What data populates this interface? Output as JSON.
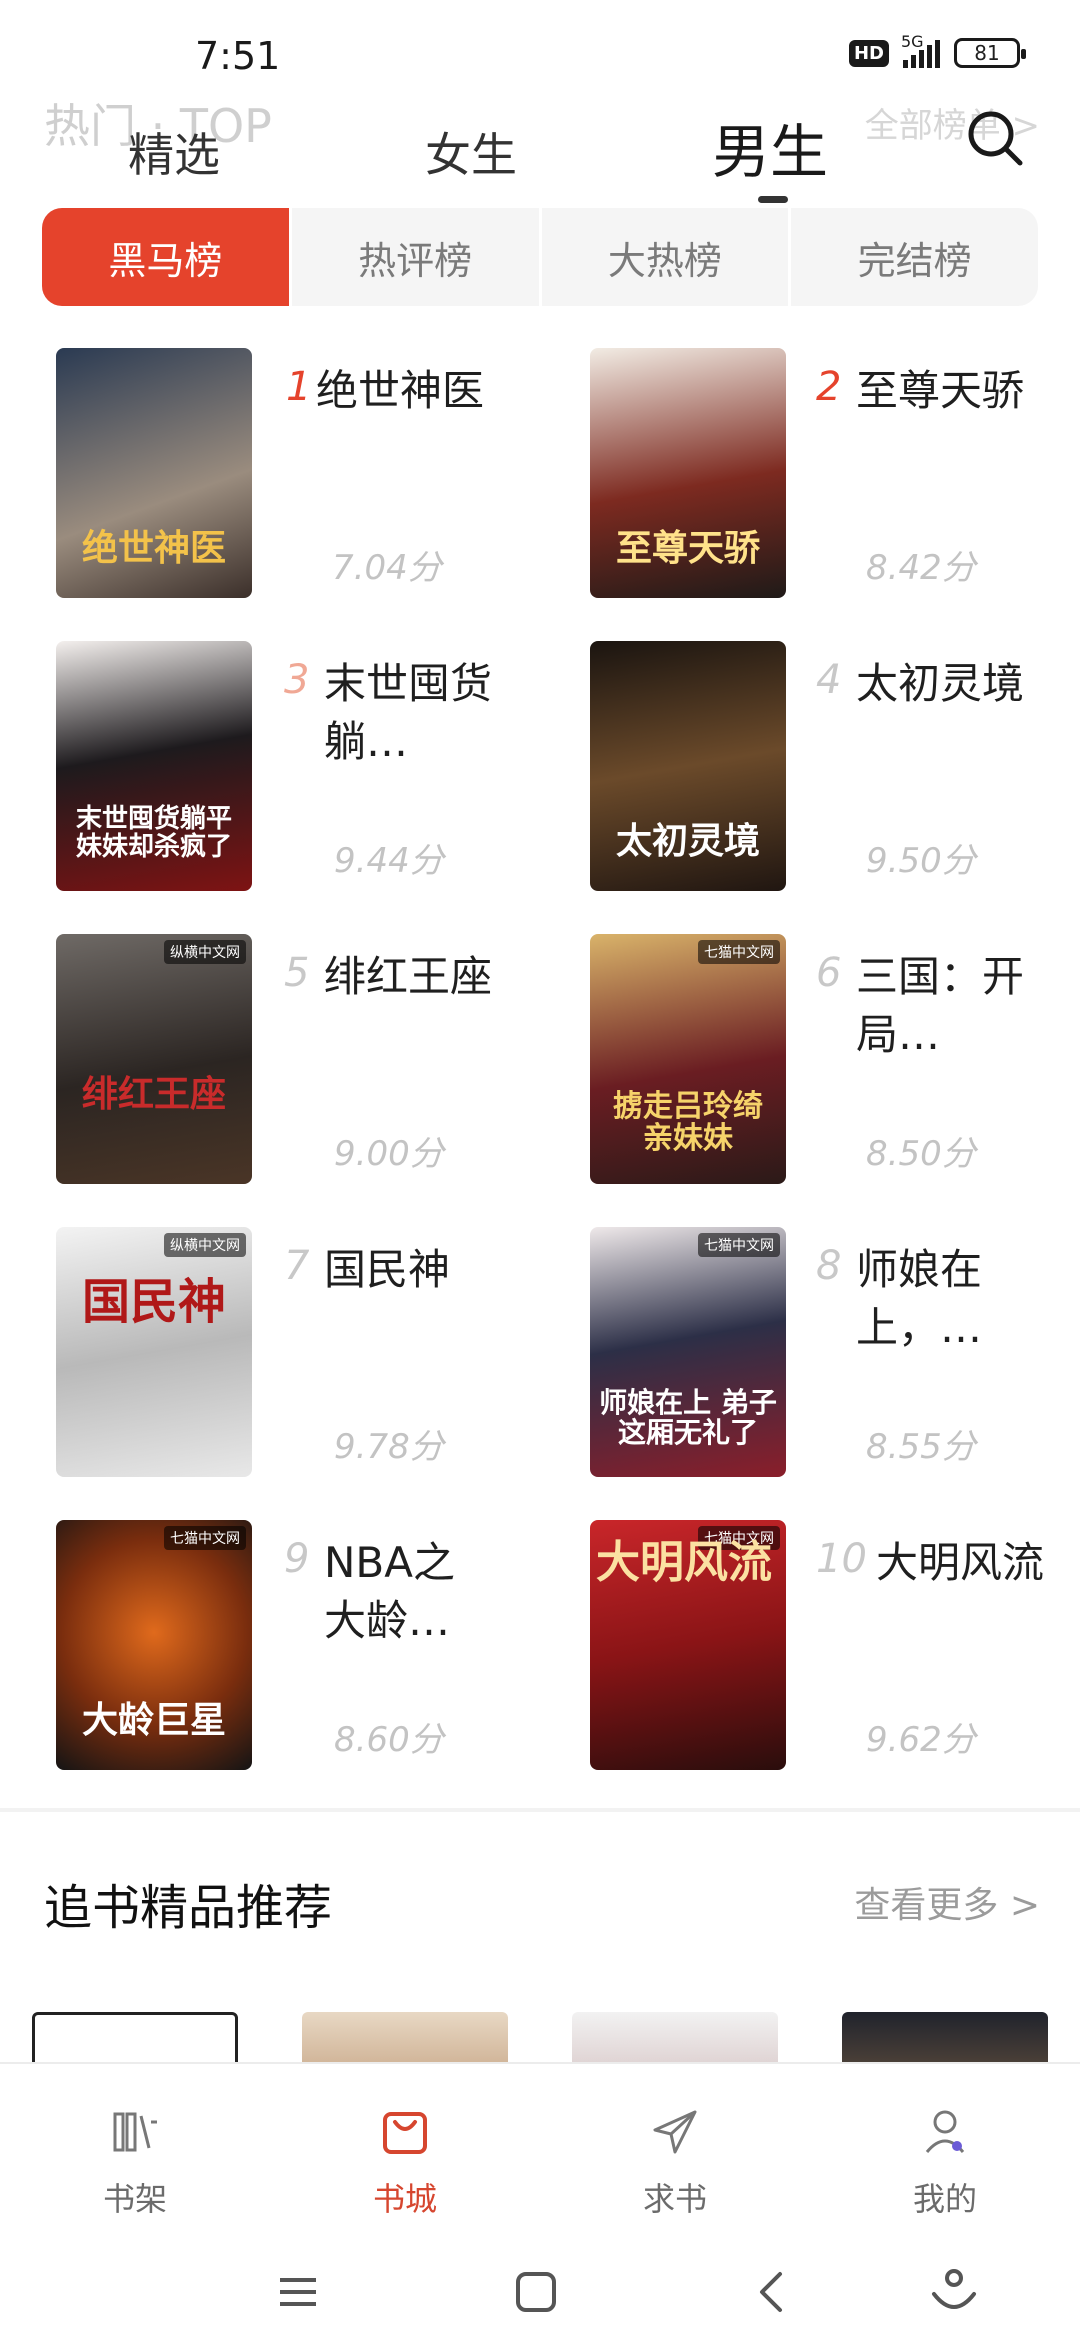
{
  "status_bar": {
    "time": "7:51",
    "hd": "HD",
    "network": "5G",
    "battery": "81"
  },
  "ghost_header": {
    "left": "热门 · TOP",
    "right": "全部榜单 >"
  },
  "top_tabs": [
    "精选",
    "女生",
    "男生"
  ],
  "rank_tabs": [
    "黑马榜",
    "热评榜",
    "大热榜",
    "完结榜"
  ],
  "books": [
    {
      "rank": "1",
      "title": "绝世神医",
      "score": "7.04分",
      "cover_text": "绝世神医"
    },
    {
      "rank": "2",
      "title": "至尊天骄",
      "score": "8.42分",
      "cover_text": "至尊天骄"
    },
    {
      "rank": "3",
      "title": "末世囤货躺…",
      "score": "9.44分",
      "cover_text": "末世囤货躺平 妹妹却杀疯了"
    },
    {
      "rank": "4",
      "title": "太初灵境",
      "score": "9.50分",
      "cover_text": "太初灵境"
    },
    {
      "rank": "5",
      "title": "绯红王座",
      "score": "9.00分",
      "cover_text": "绯红王座"
    },
    {
      "rank": "6",
      "title": "三国：开局…",
      "score": "8.50分",
      "cover_text": "掳走吕玲绮 亲妹妹"
    },
    {
      "rank": "7",
      "title": "国民神",
      "score": "9.78分",
      "cover_text": "国民神"
    },
    {
      "rank": "8",
      "title": "师娘在上，…",
      "score": "8.55分",
      "cover_text": "师娘在上 弟子这厢无礼了"
    },
    {
      "rank": "9",
      "title": "NBA之大龄…",
      "score": "8.60分",
      "cover_text": "大龄巨星"
    },
    {
      "rank": "10",
      "title": "大明风流",
      "score": "9.62分",
      "cover_text": "大明风流"
    }
  ],
  "recommend": {
    "title": "追书精品推荐",
    "more": "查看更多 >"
  },
  "bottom_nav": [
    {
      "label": "书架",
      "icon": "bookshelf-icon"
    },
    {
      "label": "书城",
      "icon": "bookstore-icon"
    },
    {
      "label": "求书",
      "icon": "request-book-icon"
    },
    {
      "label": "我的",
      "icon": "profile-icon"
    }
  ],
  "colors": {
    "accent": "#e5432c",
    "nav_active": "#d6462f",
    "muted": "#c3c3c3"
  }
}
